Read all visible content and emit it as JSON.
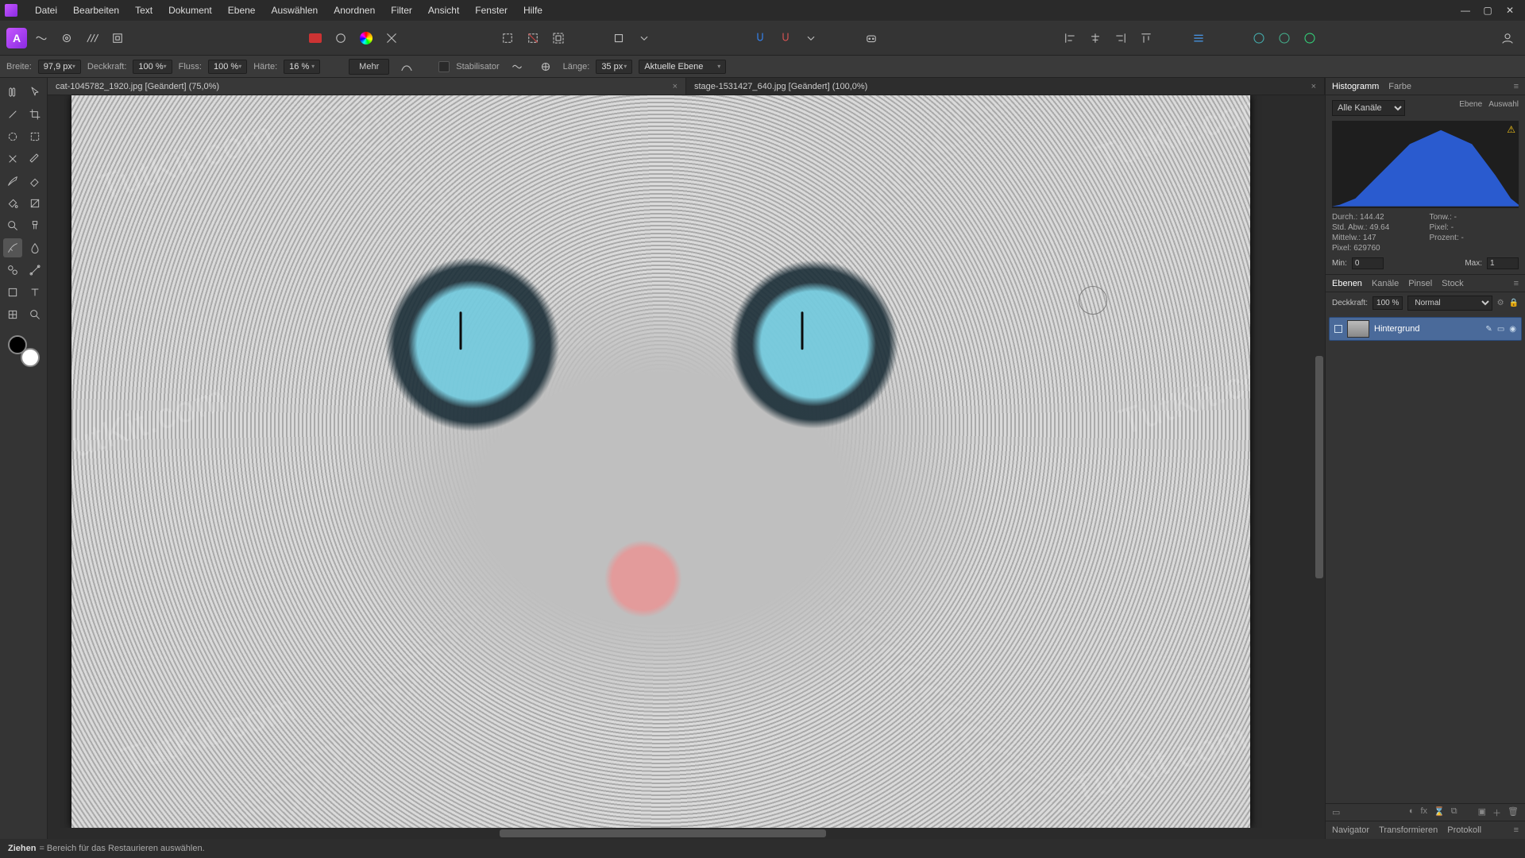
{
  "menu": {
    "items": [
      "Datei",
      "Bearbeiten",
      "Text",
      "Dokument",
      "Ebene",
      "Auswählen",
      "Anordnen",
      "Filter",
      "Ansicht",
      "Fenster",
      "Hilfe"
    ]
  },
  "context": {
    "width_label": "Breite:",
    "width_value": "97,9 px",
    "opacity_label": "Deckkraft:",
    "opacity_value": "100 %",
    "flow_label": "Fluss:",
    "flow_value": "100 %",
    "hardness_label": "Härte:",
    "hardness_value": "16 %",
    "more_label": "Mehr",
    "stabiliser_label": "Stabilisator",
    "length_label": "Länge:",
    "length_value": "35 px",
    "target_label": "Aktuelle Ebene"
  },
  "tabs": {
    "0": {
      "label": "cat-1045782_1920.jpg [Geändert] (75,0%)"
    },
    "1": {
      "label": "stage-1531427_640.jpg [Geändert] (100,0%)"
    }
  },
  "watermark": "TutKit.com",
  "histogram": {
    "tab_hist": "Histogramm",
    "tab_color": "Farbe",
    "channel": "Alle Kanäle",
    "btn_layer": "Ebene",
    "btn_selection": "Auswahl",
    "mean_label": "Durch.:",
    "mean_val": "144.42",
    "std_label": "Std. Abw.:",
    "std_val": "49.64",
    "median_label": "Mittelw.:",
    "median_val": "147",
    "pixels_label": "Pixel:",
    "pixels_val": "629760",
    "tone_label": "Tonw.:",
    "tone_val": "-",
    "pixel2_label": "Pixel:",
    "pixel2_val": "-",
    "percent_label": "Prozent:",
    "percent_val": "-",
    "min_label": "Min:",
    "min_val": "0",
    "max_label": "Max:",
    "max_val": "1"
  },
  "layers": {
    "tab_layers": "Ebenen",
    "tab_channels": "Kanäle",
    "tab_brushes": "Pinsel",
    "tab_stock": "Stock",
    "opacity_label": "Deckkraft:",
    "opacity_value": "100 %",
    "blend_value": "Normal",
    "layer0_name": "Hintergrund"
  },
  "bottom_tabs": {
    "nav": "Navigator",
    "transform": "Transformieren",
    "protocol": "Protokoll"
  },
  "status": {
    "action": "Ziehen",
    "hint": " = Bereich für das Restaurieren auswählen."
  }
}
